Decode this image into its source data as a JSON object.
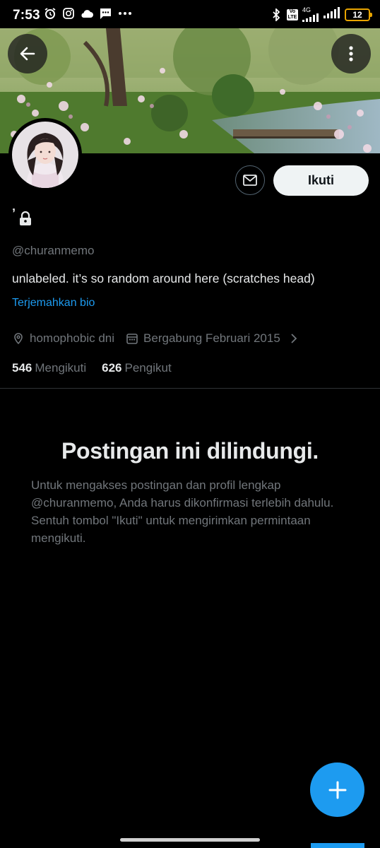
{
  "status_bar": {
    "time": "7:53",
    "network": "4G",
    "volte": "Vo LTE",
    "battery": "12",
    "colors": {
      "battery": "#e8a400"
    }
  },
  "profile": {
    "display_name": "ʼ",
    "handle": "@churanmemo",
    "bio": "unlabeled. it’s so random around here (scratches head)",
    "translate_bio": "Terjemahkan bio",
    "location": "homophobic dni",
    "joined": "Bergabung Februari 2015",
    "following_count": "546",
    "following_label": "Mengikuti",
    "followers_count": "626",
    "followers_label": "Pengikut"
  },
  "actions": {
    "follow_label": "Ikuti"
  },
  "protected": {
    "title": "Postingan ini dilindungi.",
    "body": "Untuk mengakses postingan dan profil lengkap @churanmemo, Anda harus dikonfirmasi terlebih dahulu. Sentuh tombol \"Ikuti\" untuk mengirimkan permintaan mengikuti."
  },
  "icons": {
    "back": "arrow-left-icon",
    "more": "more-vertical-icon",
    "message": "envelope-icon",
    "lock": "lock-icon",
    "location": "location-pin-icon",
    "calendar": "calendar-icon",
    "chevron": "chevron-right-icon",
    "fab": "plus-icon"
  },
  "colors": {
    "accent": "#1d9bf0",
    "muted_text": "#71767b",
    "primary_text": "#e7e9ea",
    "background": "#000000"
  }
}
